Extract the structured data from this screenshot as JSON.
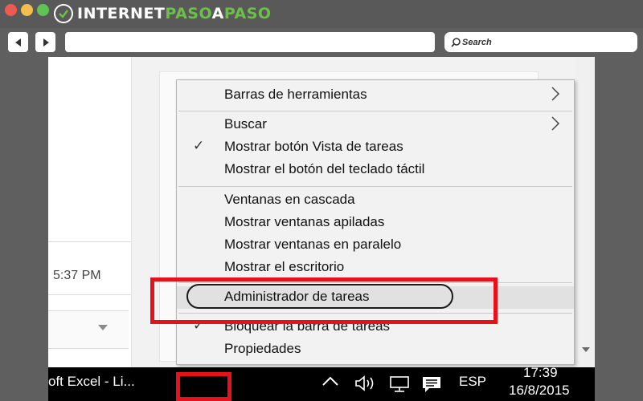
{
  "browser": {
    "logo": {
      "part1": "INTERNET",
      "part2": "PASO",
      "part3": "A",
      "part4": "PASO"
    },
    "search_placeholder": "Search",
    "colors": {
      "close": "#ee5a52",
      "minimize": "#f4be4f",
      "maximize": "#5fc454",
      "brand_green": "#6cc04a"
    }
  },
  "app": {
    "time_text": "5:37 PM"
  },
  "context_menu": {
    "items": [
      {
        "label": "Barras de herramientas",
        "submenu": true,
        "checked": false
      },
      {
        "label": "Buscar",
        "submenu": true,
        "checked": false
      },
      {
        "label": "Mostrar botón Vista de tareas",
        "submenu": false,
        "checked": true
      },
      {
        "label": "Mostrar el botón del teclado táctil",
        "submenu": false,
        "checked": false
      },
      {
        "label": "Ventanas en cascada",
        "submenu": false,
        "checked": false
      },
      {
        "label": "Mostrar ventanas apiladas",
        "submenu": false,
        "checked": false
      },
      {
        "label": "Mostrar ventanas en paralelo",
        "submenu": false,
        "checked": false
      },
      {
        "label": "Mostrar el escritorio",
        "submenu": false,
        "checked": false
      },
      {
        "label": "Administrador de tareas",
        "submenu": false,
        "checked": false,
        "highlighted": true
      },
      {
        "label": "Bloquear la barra de tareas",
        "submenu": false,
        "checked": true
      },
      {
        "label": "Propiedades",
        "submenu": false,
        "checked": false
      }
    ],
    "check_glyph": "✓"
  },
  "taskbar": {
    "app_label": "oft Excel - Li...",
    "language": "ESP",
    "clock_time": "17:39",
    "clock_date": "16/8/2015",
    "icons": [
      "chevron-up-icon",
      "volume-icon",
      "network-icon",
      "notification-icon"
    ]
  },
  "annotations": {
    "highlight_color": "#e8101a"
  }
}
